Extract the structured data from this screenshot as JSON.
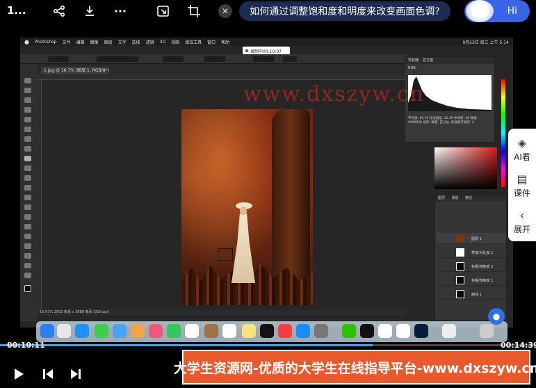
{
  "player": {
    "title": "1...",
    "question": "如何通过调整饱和度和明度来改变画面色调?",
    "hi_label": "Hi",
    "close_glyph": "✕",
    "time_current": "00:10:11",
    "time_total": "00:14:39",
    "progress_fraction": 0.695,
    "accent": "#3ba7ff"
  },
  "icons": {
    "share": "share-icon",
    "download": "download-icon",
    "more": "more-icon",
    "picture_in_picture": "pip-icon",
    "crop": "crop-icon",
    "play": "play-icon",
    "prev": "previous-icon",
    "next": "next-icon"
  },
  "side_panel": {
    "items": [
      {
        "label": "AI看",
        "icon": "ai-watch-icon"
      },
      {
        "label": "课件",
        "icon": "courseware-icon"
      },
      {
        "label": "展开",
        "icon": "chevron-left-icon"
      }
    ]
  },
  "photoshop": {
    "app_name": "Photoshop",
    "menu": [
      "文件",
      "编辑",
      "图像",
      "图层",
      "文字",
      "选择",
      "滤镜",
      "3D",
      "视图",
      "增效工具",
      "窗口",
      "帮助"
    ],
    "recording": "录制中00:10:07",
    "clock": "9月23日 周三 上午 5:14",
    "doc_tab": "1.jpg @ 16.7% (图层 1, RGB/8*)",
    "status": "16.67%  2592 像素 x 3888 像素 (300 ppi)",
    "histogram_tabs": [
      "导航器",
      "直方图"
    ],
    "histogram_channel": "RGB",
    "histogram_stats": "平均值: 60.70  标准偏差: 32.39  中间值: 48  像素: 4969056  色阶:  数量:  百分位:  高速缓存级别: 4",
    "layers_tabs": [
      "图层",
      "通道",
      "路径"
    ],
    "layers": [
      {
        "name": "图层 1"
      },
      {
        "name": "亮度/对比度 1"
      },
      {
        "name": "色相/饱和度 2"
      },
      {
        "name": "色相/饱和度 1"
      },
      {
        "name": "曲线 1"
      }
    ]
  },
  "watermark": "www.dxszyw.cn",
  "banner": "大学生资源网-优质的大学生在线指导平台-www.dxszyw.cn"
}
